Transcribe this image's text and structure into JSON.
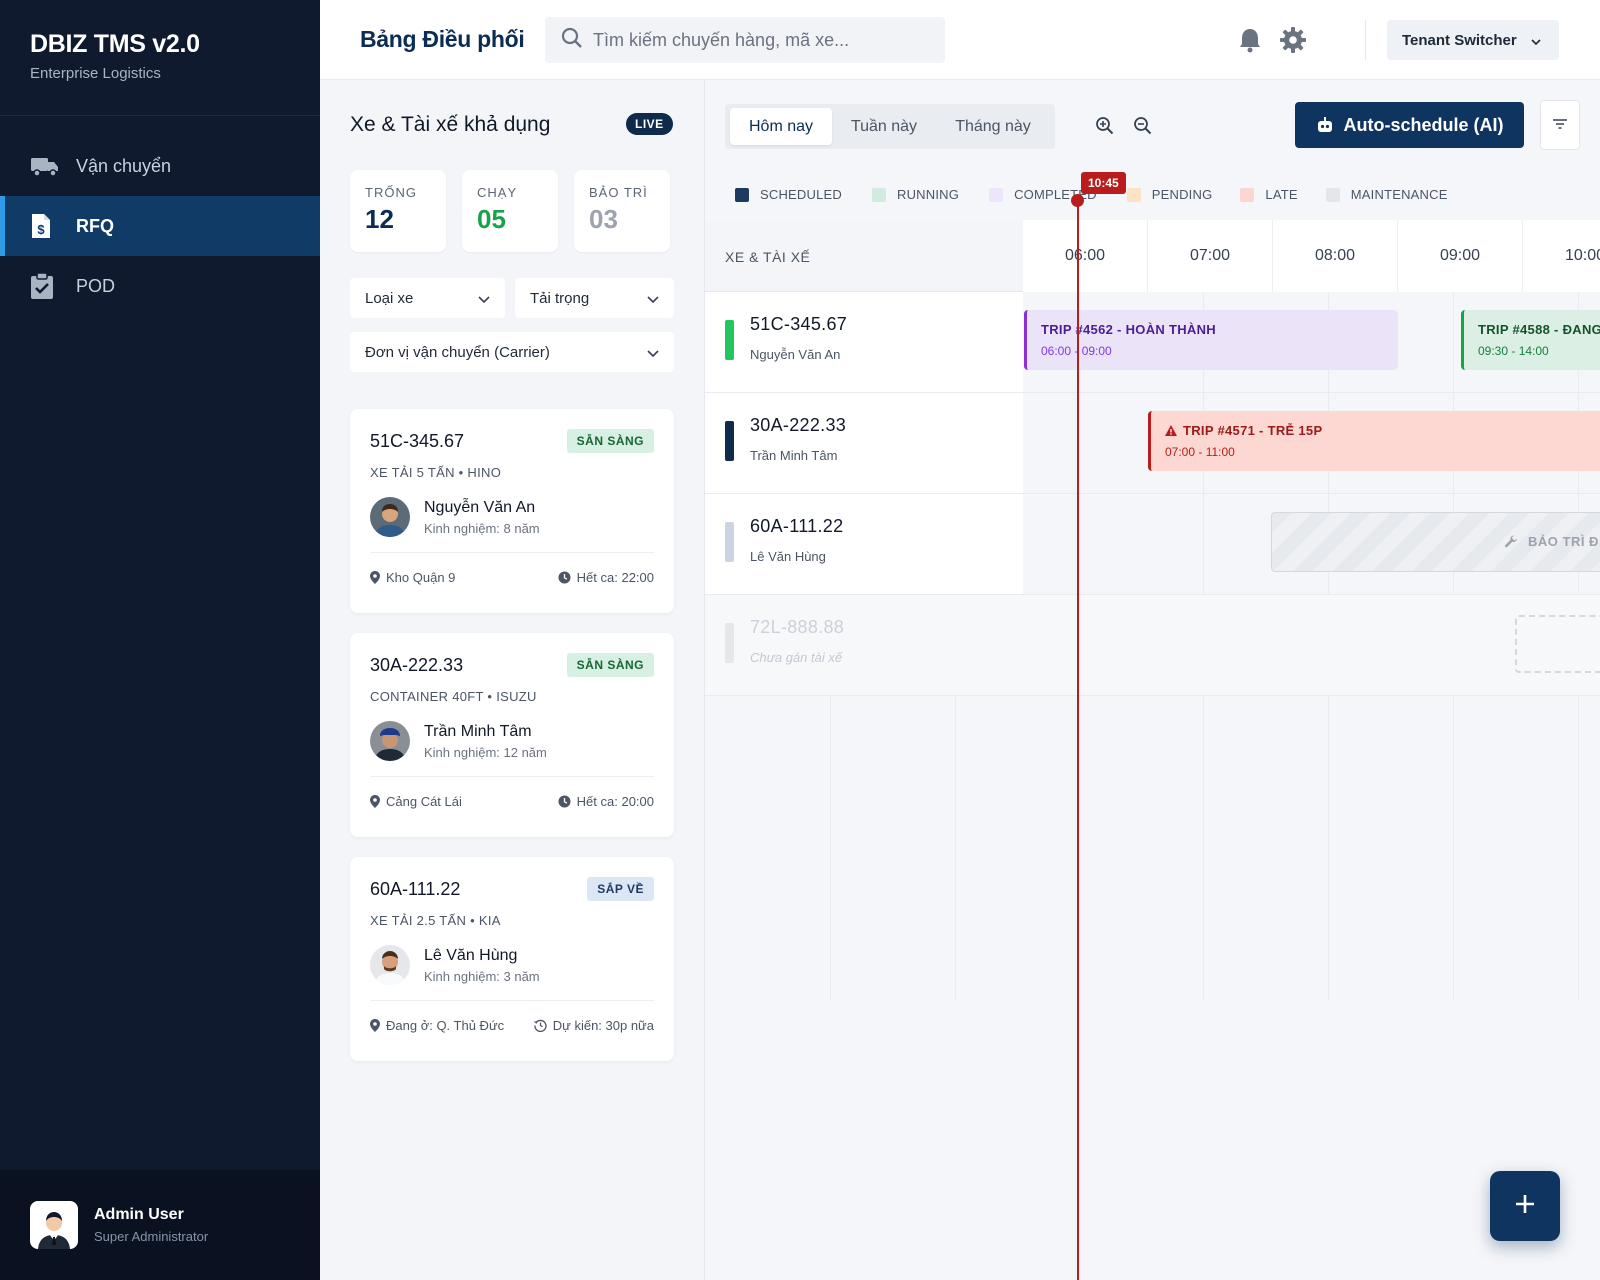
{
  "brand": {
    "title": "DBIZ TMS v2.0",
    "subtitle": "Enterprise Logistics"
  },
  "nav": [
    {
      "label": "Vận chuyển",
      "icon": "truck-icon",
      "active": false
    },
    {
      "label": "RFQ",
      "icon": "invoice-dollar-icon",
      "active": true
    },
    {
      "label": "POD",
      "icon": "clipboard-check-icon",
      "active": false
    }
  ],
  "user": {
    "name": "Admin User",
    "role": "Super Administrator",
    "icon": "user-avatar-icon"
  },
  "header": {
    "title": "Bảng Điều phối",
    "search_placeholder": "Tìm kiếm chuyến hàng, mã xe...",
    "tenant_label": "Tenant Switcher",
    "icons": [
      "bell-icon",
      "gear-icon"
    ]
  },
  "panel": {
    "title": "Xe & Tài xế khả dụng",
    "live": "LIVE",
    "stats": [
      {
        "label": "TRỐNG",
        "value": "12",
        "color": "#0d2c54"
      },
      {
        "label": "CHẠY",
        "value": "05",
        "color": "#16a34a"
      },
      {
        "label": "BẢO TRÌ",
        "value": "03",
        "color": "#9ca3af"
      }
    ],
    "filters": {
      "vehicle_type": "Loại xe",
      "load": "Tải trọng",
      "carrier": "Đơn vị vận chuyển (Carrier)"
    },
    "vehicles": [
      {
        "plate": "51C-345.67",
        "badge": "SẴN SÀNG",
        "type": "XE TẢI 5 TẤN • HINO",
        "driver": "Nguyễn Văn An",
        "exp": "Kinh nghiệm: 8 năm",
        "location": "Kho Quận 9",
        "shift": "Hết ca: 22:00"
      },
      {
        "plate": "30A-222.33",
        "badge": "SẴN SÀNG",
        "type": "CONTAINER 40FT • ISUZU",
        "driver": "Trần Minh Tâm",
        "exp": "Kinh nghiệm: 12 năm",
        "location": "Cảng Cát Lái",
        "shift": "Hết ca: 20:00"
      },
      {
        "plate": "60A-111.22",
        "badge": "SẮP VỀ",
        "type": "XE TẢI 2.5 TẤN • KIA",
        "driver": "Lê Văn Hùng",
        "exp": "Kinh nghiệm: 3 năm",
        "location": "Đang ở: Q. Thủ Đức",
        "shift": "Dự kiến: 30p nữa"
      }
    ]
  },
  "timeline": {
    "tabs": [
      "Hôm nay",
      "Tuần này",
      "Tháng này"
    ],
    "active_tab": "Hôm nay",
    "auto_schedule": "Auto-schedule (AI)",
    "legend": [
      {
        "label": "SCHEDULED",
        "color": "#1e3a5f"
      },
      {
        "label": "RUNNING",
        "color": "#d1ebe0"
      },
      {
        "label": "COMPLETED",
        "color": "#ede6fb"
      },
      {
        "label": "PENDING",
        "color": "#fde3c2"
      },
      {
        "label": "LATE",
        "color": "#fcd7d2"
      },
      {
        "label": "MAINTENANCE",
        "color": "#e3e6eb"
      }
    ],
    "column_header": "XE & TÀI XẾ",
    "hours": [
      "06:00",
      "07:00",
      "08:00",
      "09:00",
      "10:00"
    ],
    "now": "10:45",
    "rows": [
      {
        "plate": "51C-345.67",
        "driver": "Nguyễn Văn An",
        "bar_color": "#22c55e"
      },
      {
        "plate": "30A-222.33",
        "driver": "Trần Minh Tâm",
        "bar_color": "#0f2b4c"
      },
      {
        "plate": "60A-111.22",
        "driver": "Lê Văn Hùng",
        "bar_color": "#cbd5e1"
      },
      {
        "plate": "72L-888.88",
        "driver": "Chưa gán tài xế",
        "bar_color": "#e5e7eb"
      }
    ],
    "trips": [
      {
        "title": "TRIP #4562 - HOÀN THÀNH",
        "time": "06:00 - 09:00",
        "status": "completed"
      },
      {
        "title": "TRIP #4588 - ĐANG",
        "time": "09:30 - 14:00",
        "status": "running"
      },
      {
        "title": "TRIP #4571 - TRỄ 15P",
        "time": "07:00 - 11:00",
        "status": "late"
      },
      {
        "title": "BẢO TRÌ Đ",
        "status": "maintenance"
      }
    ]
  }
}
